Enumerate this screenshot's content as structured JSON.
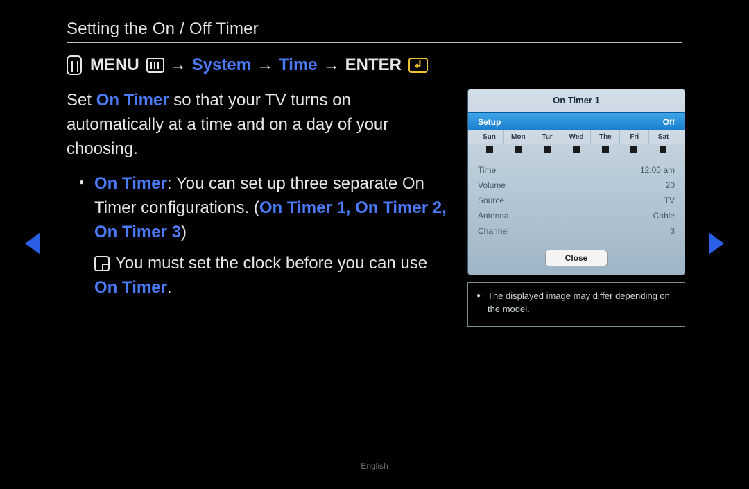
{
  "title": "Setting the On / Off Timer",
  "nav": {
    "menu": "MENU",
    "system": "System",
    "time": "Time",
    "enter": "ENTER",
    "arrow": "→"
  },
  "intro": {
    "pre": "Set ",
    "on_timer": "On Timer",
    "post": " so that your TV turns on automatically at a time and on a day of your choosing."
  },
  "bullet1": {
    "label": "On Timer",
    "text_a": ": You can set up three separate On Timer configurations. (",
    "names": "On Timer 1, On Timer 2, On Timer 3",
    "text_b": ")"
  },
  "note": {
    "pre": "You must set the clock before you can use ",
    "on_timer": "On Timer",
    "post": "."
  },
  "dialog": {
    "title": "On Timer 1",
    "setup_label": "Setup",
    "setup_value": "Off",
    "days": [
      "Sun",
      "Mon",
      "Tur",
      "Wed",
      "The",
      "Fri",
      "Sat"
    ],
    "rows": [
      {
        "label": "Time",
        "value": "12:00 am"
      },
      {
        "label": "Volume",
        "value": "20"
      },
      {
        "label": "Source",
        "value": "TV"
      },
      {
        "label": "Antenna",
        "value": "Cable"
      },
      {
        "label": "Channel",
        "value": "3"
      }
    ],
    "close": "Close"
  },
  "caption": "The displayed image may differ depending on the model.",
  "footer_lang": "English"
}
